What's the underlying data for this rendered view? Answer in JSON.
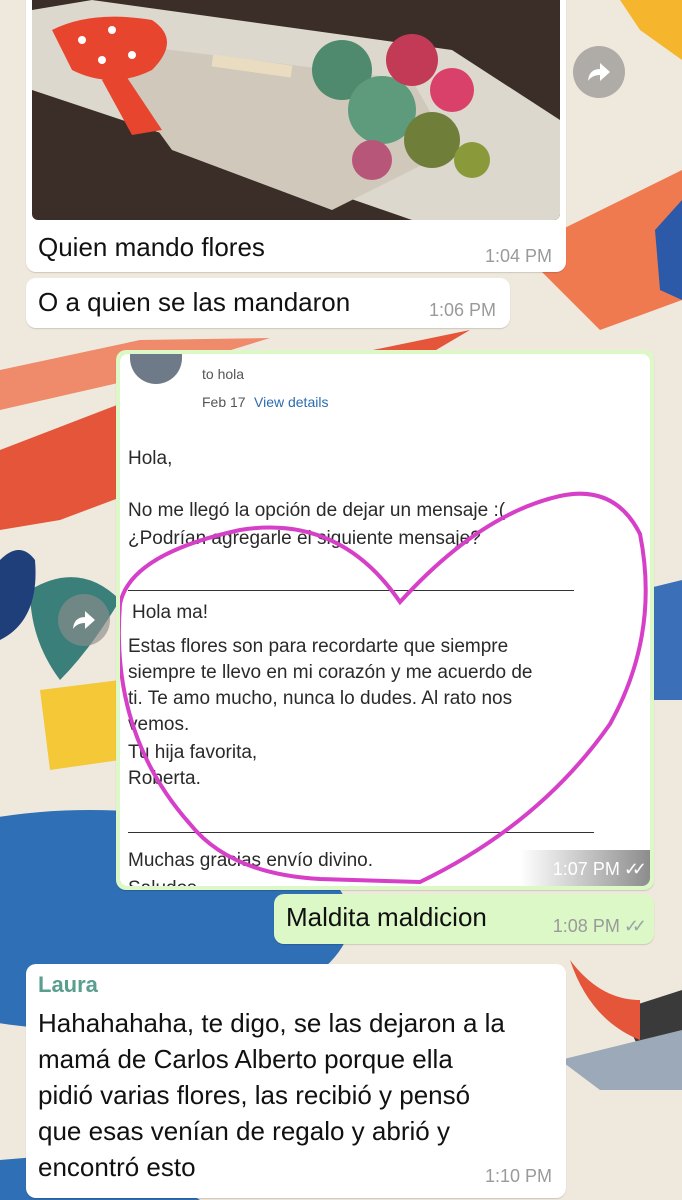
{
  "messages": [
    {
      "text": "Quien mando flores",
      "time": "1:04 PM"
    },
    {
      "text": "O a quien se las mandaron",
      "time": "1:06 PM"
    },
    {
      "time": "1:07 PM",
      "ticks": "✓✓",
      "screenshot": {
        "recipient": "to hola",
        "date": "Feb 17",
        "details_link": "View details",
        "lines": [
          "Hola,",
          "No me llegó la opción de dejar un mensaje :(",
          "¿Podrían agregarle el siguiente mensaje?",
          "Hola ma!",
          "Estas flores son para recordarte que siempre",
          "siempre te llevo en mi corazón y me acuerdo de",
          "ti. Te amo mucho, nunca lo dudes. Al rato nos",
          "vemos.",
          "Tu hija favorita,",
          "Roberta.",
          "Muchas gracias envío divino.",
          "Saludos"
        ]
      }
    },
    {
      "text": "Maldita maldicion",
      "time": "1:08 PM",
      "ticks": "✓✓"
    },
    {
      "sender": "Laura",
      "lines": [
        "Hahahahaha, te digo, se las dejaron a la",
        "mamá de Carlos Alberto porque ella",
        "pidió varias flores, las recibió y pensó",
        "que esas venían de regalo y abrió y",
        "encontró esto"
      ],
      "time": "1:10 PM"
    }
  ],
  "icons": {
    "forward": "forward-arrow-icon",
    "read": "double-check-icon"
  },
  "colors": {
    "incoming": "#ffffff",
    "outgoing": "#dcf8c6",
    "sender_name": "#5a9e8f",
    "heart_drawing": "#d63fc7"
  }
}
